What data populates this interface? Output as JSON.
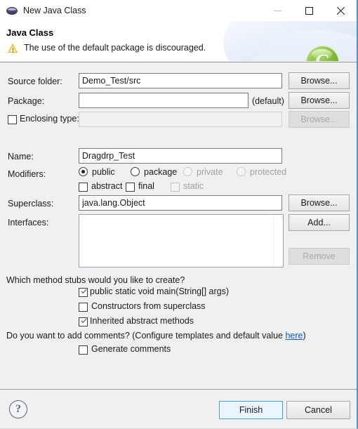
{
  "window": {
    "title": "New Java Class",
    "icon": "java-class-icon",
    "controls": {
      "minimize": "minimize-icon",
      "maximize": "maximize-icon",
      "close": "close-icon"
    }
  },
  "header": {
    "title": "Java Class",
    "message": "The use of the default package is discouraged.",
    "message_icon": "warning-icon",
    "badge_letter": "C",
    "accent_color": "#3d9ae0",
    "badge_color": "#8dc63f",
    "warning_color": "#efb81c"
  },
  "form": {
    "source_folder": {
      "label": "Source folder:",
      "value": "Demo_Test/src",
      "browse": "Browse..."
    },
    "package": {
      "label": "Package:",
      "value": "",
      "placeholder": "",
      "suffix": "(default)",
      "browse": "Browse..."
    },
    "enclosing_type": {
      "label": "Enclosing type:",
      "checked": false,
      "value": "",
      "browse": "Browse...",
      "disabled": true
    },
    "name": {
      "label": "Name:",
      "value": "Dragdrp_Test"
    },
    "modifiers": {
      "label": "Modifiers:",
      "radios": [
        {
          "label": "public",
          "selected": true,
          "disabled": false
        },
        {
          "label": "package",
          "selected": false,
          "disabled": false
        },
        {
          "label": "private",
          "selected": false,
          "disabled": true
        },
        {
          "label": "protected",
          "selected": false,
          "disabled": true
        }
      ],
      "checkboxes": [
        {
          "label": "abstract",
          "checked": false,
          "disabled": false
        },
        {
          "label": "final",
          "checked": false,
          "disabled": false
        },
        {
          "label": "static",
          "checked": false,
          "disabled": true
        }
      ]
    },
    "superclass": {
      "label": "Superclass:",
      "value": "java.lang.Object",
      "browse": "Browse..."
    },
    "interfaces": {
      "label": "Interfaces:",
      "items": [],
      "add": "Add...",
      "remove": "Remove",
      "remove_disabled": true
    }
  },
  "stubs": {
    "question": "Which method stubs would you like to create?",
    "options": [
      {
        "label": "public static void main(String[] args)",
        "checked": true
      },
      {
        "label": "Constructors from superclass",
        "checked": false
      },
      {
        "label": "Inherited abstract methods",
        "checked": true
      }
    ]
  },
  "comments": {
    "question_before": "Do you want to add comments? (Configure templates and default value ",
    "link": "here",
    "question_after": ")",
    "option": {
      "label": "Generate comments",
      "checked": false
    }
  },
  "footer": {
    "help_icon": "help-icon",
    "finish": "Finish",
    "cancel": "Cancel"
  }
}
